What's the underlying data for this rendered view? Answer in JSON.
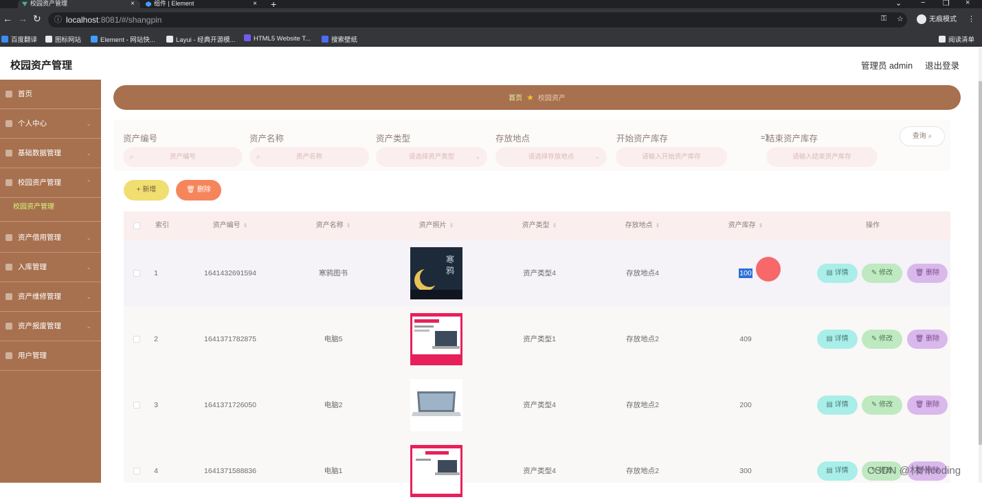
{
  "browser": {
    "tabs": [
      {
        "label": "校园资产管理",
        "active": true
      },
      {
        "label": "组件 | Element",
        "active": false
      }
    ],
    "url_host": "localhost",
    "url_path": ":8081/#/shangpin",
    "profile_label": "无痕模式",
    "bookmarks": [
      "百度翻译",
      "图标网站",
      "Element - 网站快...",
      "Layui - 经典开源模...",
      "HTML5 Website T...",
      "搜索壁纸"
    ],
    "reading_list": "阅读清单"
  },
  "header": {
    "title": "校园资产管理",
    "admin": "管理员 admin",
    "logout": "退出登录"
  },
  "sidebar": {
    "items": [
      {
        "label": "首页",
        "icon": "home-icon"
      },
      {
        "label": "个人中心",
        "icon": "user-icon"
      },
      {
        "label": "基础数据管理",
        "icon": "menu-icon"
      },
      {
        "label": "校园资产管理",
        "icon": "asset-icon"
      },
      {
        "label": "资产借用管理",
        "icon": "borrow-icon"
      },
      {
        "label": "入库管理",
        "icon": "inbound-icon"
      },
      {
        "label": "资产维修管理",
        "icon": "repair-icon"
      },
      {
        "label": "资产报废管理",
        "icon": "scrap-icon"
      },
      {
        "label": "用户管理",
        "icon": "users-icon"
      }
    ],
    "sub_item": "校园资产管理"
  },
  "breadcrumb": {
    "home": "首页",
    "current": "校园资产"
  },
  "search": {
    "fields": [
      {
        "label": "资产编号",
        "placeholder": "资产编号"
      },
      {
        "label": "资产名称",
        "placeholder": "资产名称"
      },
      {
        "label": "资产类型",
        "placeholder": "请选择资产类型"
      },
      {
        "label": "存放地点",
        "placeholder": "请选择存放地点"
      },
      {
        "label": "开始资产库存",
        "placeholder": "请输入开始资产库存"
      },
      {
        "label": "结束资产库存",
        "placeholder": "请输入结束资产库存"
      }
    ],
    "arrow": "=》",
    "query_button": "查询"
  },
  "actions": {
    "add": "新增",
    "delete": "删除"
  },
  "table": {
    "columns": [
      "索引",
      "资产编号",
      "资产名称",
      "资产照片",
      "资产类型",
      "存放地点",
      "资产库存",
      "操作"
    ],
    "rows": [
      {
        "index": "1",
        "code": "1641432691594",
        "name": "寒鸦图书",
        "type": "资产类型4",
        "location": "存放地点4",
        "stock": "100"
      },
      {
        "index": "2",
        "code": "1641371782875",
        "name": "电脑5",
        "type": "资产类型1",
        "location": "存放地点2",
        "stock": "409"
      },
      {
        "index": "3",
        "code": "1641371726050",
        "name": "电脑2",
        "type": "资产类型4",
        "location": "存放地点2",
        "stock": "200"
      },
      {
        "index": "4",
        "code": "1641371588836",
        "name": "电脑1",
        "type": "资产类型4",
        "location": "存放地点2",
        "stock": "300"
      }
    ],
    "row_actions": {
      "detail": "详情",
      "edit": "修改",
      "remove": "删除"
    }
  },
  "watermark": "CSDN @林州coding",
  "colors": {
    "sidebar": "#a7704e",
    "active_sub": "#d3f77b",
    "add_btn": "#f0de70",
    "delete_btn": "#f7855c"
  }
}
